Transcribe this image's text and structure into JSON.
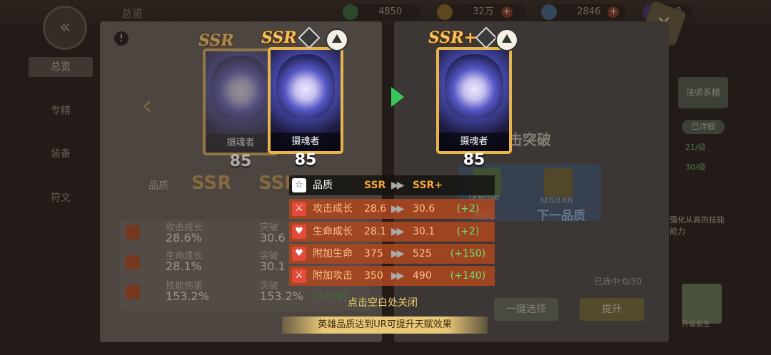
{
  "top_bar": {
    "tab_title": "总览",
    "resources": [
      {
        "icon": "clover-icon",
        "value": "4850",
        "color": "#3aa657"
      },
      {
        "icon": "gold-coin-icon",
        "value": "32万",
        "color": "#d8a531"
      },
      {
        "icon": "diamond-icon",
        "value": "2846",
        "color": "#7fb3e8"
      },
      {
        "icon": "energy-icon",
        "value": "0",
        "color": "#8a7ad8"
      }
    ],
    "plus_label": "+"
  },
  "side_nav": [
    "总览",
    "专精",
    "装备",
    "符文"
  ],
  "background_panel": {
    "quality_label": "品质",
    "quality_from": "SSR",
    "quality_to": "SSR",
    "stats": [
      {
        "label": "攻击成长",
        "value": "28.6%",
        "next_label": "突破",
        "next_value": "30.6"
      },
      {
        "label": "生命成长",
        "value": "28.1%",
        "next_label": "突破",
        "next_value": "30.1"
      },
      {
        "label": "技能伤害",
        "value": "153.2%",
        "next_label": "突破",
        "next_value": "153.2%"
      }
    ],
    "skill_delta": "(+0%)",
    "right_title": "击突破",
    "right_sub": "下一品质",
    "material_counts": [
      "1830/200",
      "32万/2.0万"
    ],
    "selected": "已选中:0/30",
    "quick_select": "一键选择",
    "upgrade": "提升",
    "consume": "消耗",
    "side_buttons": [
      "法师系精",
      "已详细"
    ],
    "side_levels": [
      "21/级",
      "30/级"
    ],
    "side_note": "强化从高的技能能力",
    "corner_label": "升级前生"
  },
  "cards": {
    "back": {
      "rank": "SSR",
      "name": "摄魂者",
      "level": "85"
    },
    "current": {
      "rank": "SSR",
      "name": "摄魂者",
      "level": "85"
    },
    "next": {
      "rank": "SSR+",
      "name": "摄魂者",
      "level": "85"
    }
  },
  "comparison": {
    "quality": {
      "icon": "star-outline-icon",
      "label": "品质",
      "from": "SSR",
      "to": "SSR+",
      "delta": ""
    },
    "rows": [
      {
        "icon": "attack-growth-icon",
        "label": "攻击成长",
        "from": "28.6",
        "to": "30.6",
        "delta": "(+2)"
      },
      {
        "icon": "hp-growth-icon",
        "label": "生命成长",
        "from": "28.1",
        "to": "30.1",
        "delta": "(+2)"
      },
      {
        "icon": "bonus-hp-icon",
        "label": "附加生命",
        "from": "375",
        "to": "525",
        "delta": "(+150)"
      },
      {
        "icon": "bonus-attack-icon",
        "label": "附加攻击",
        "from": "350",
        "to": "490",
        "delta": "(+140)"
      }
    ],
    "arrow": "▶▶"
  },
  "close_hint": "点击空白处关闭",
  "banner": "英雄品质达到UR可提升天赋效果",
  "colors": {
    "accent": "#f5a63a",
    "delta": "#6ee06a",
    "row_bg": "#b0461e",
    "arrow": "#36c95a"
  }
}
